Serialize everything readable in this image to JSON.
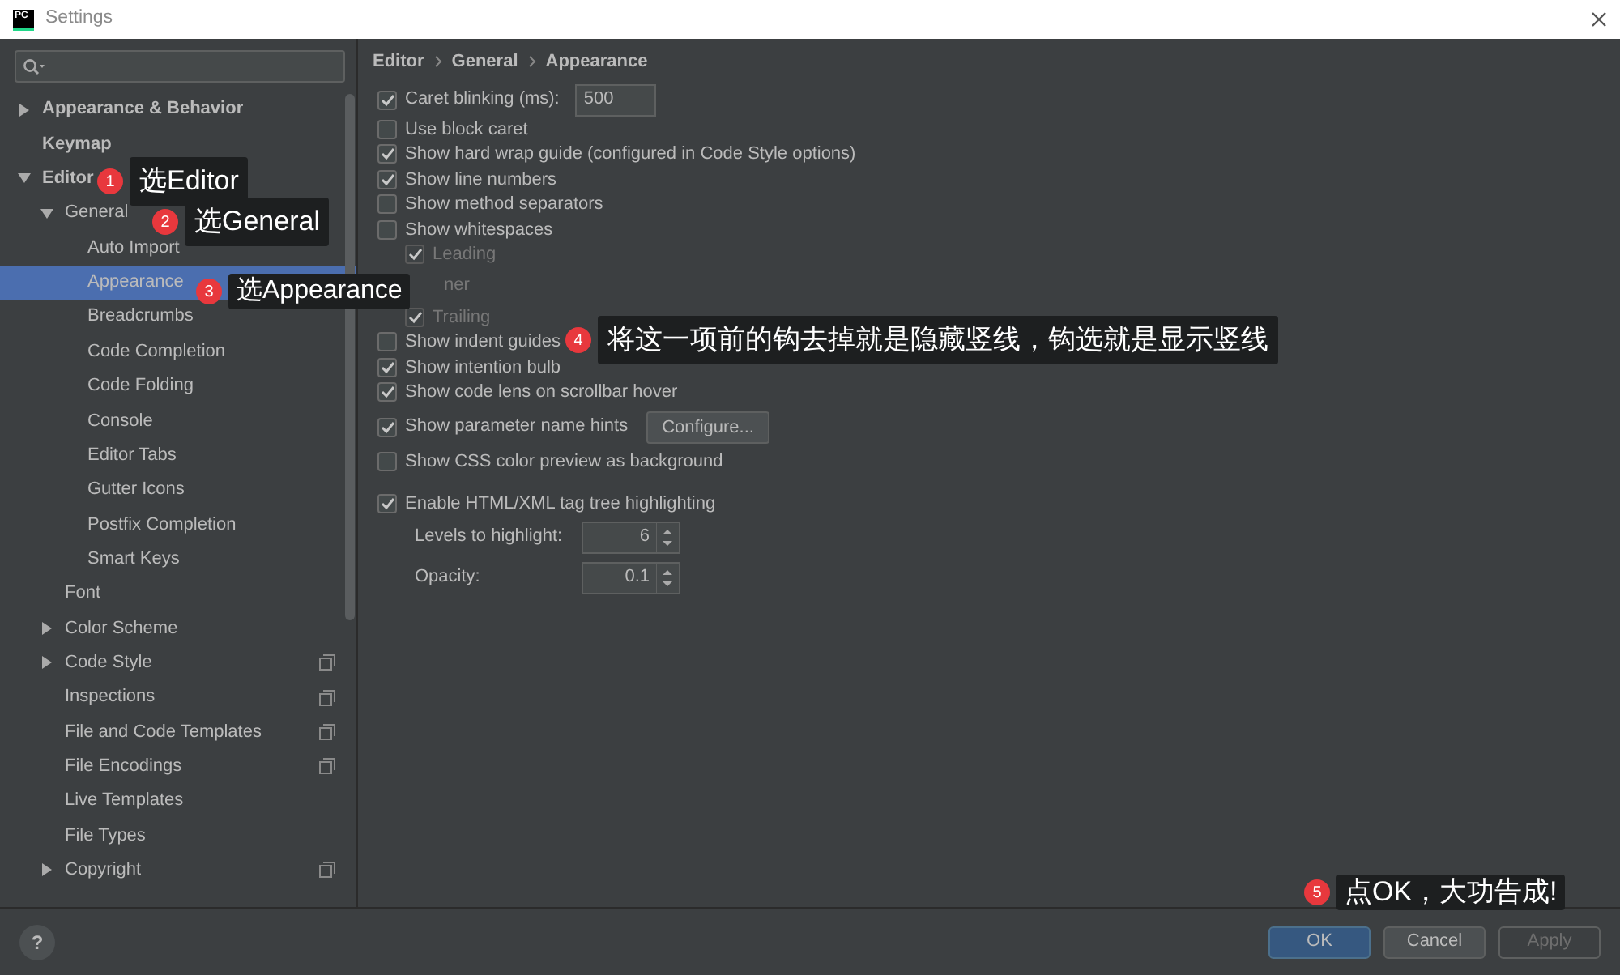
{
  "window": {
    "app_badge": "PC",
    "title": "Settings"
  },
  "sidebar": {
    "items": [
      {
        "label": "Appearance & Behavior",
        "expanded": false,
        "selected": false
      },
      {
        "label": "Keymap",
        "selected": false
      },
      {
        "label": "Editor",
        "expanded": true,
        "selected": false,
        "children": [
          {
            "label": "General",
            "expanded": true,
            "selected": false,
            "children": [
              {
                "label": "Auto Import",
                "selected": false
              },
              {
                "label": "Appearance",
                "selected": true
              },
              {
                "label": "Breadcrumbs",
                "selected": false
              },
              {
                "label": "Code Completion",
                "selected": false
              },
              {
                "label": "Code Folding",
                "selected": false
              },
              {
                "label": "Console",
                "selected": false
              },
              {
                "label": "Editor Tabs",
                "selected": false
              },
              {
                "label": "Gutter Icons",
                "selected": false
              },
              {
                "label": "Postfix Completion",
                "selected": false
              },
              {
                "label": "Smart Keys",
                "selected": false
              }
            ]
          },
          {
            "label": "Font",
            "selected": false
          },
          {
            "label": "Color Scheme",
            "expanded": false,
            "selected": false
          },
          {
            "label": "Code Style",
            "expanded": false,
            "selected": false,
            "project": true
          },
          {
            "label": "Inspections",
            "selected": false,
            "project": true
          },
          {
            "label": "File and Code Templates",
            "selected": false,
            "project": true
          },
          {
            "label": "File Encodings",
            "selected": false,
            "project": true
          },
          {
            "label": "Live Templates",
            "selected": false
          },
          {
            "label": "File Types",
            "selected": false
          },
          {
            "label": "Copyright",
            "expanded": false,
            "selected": false,
            "project": true
          }
        ]
      }
    ]
  },
  "breadcrumbs": [
    "Editor",
    "General",
    "Appearance"
  ],
  "option_groups": [
    {
      "items": [
        {
          "kind": "checkbox",
          "label": "Caret blinking (ms):",
          "checked": true,
          "field": "500"
        },
        {
          "kind": "checkbox",
          "label": "Use block caret",
          "checked": false
        },
        {
          "kind": "checkbox",
          "label": "Show hard wrap guide (configured in Code Style options)",
          "checked": true
        },
        {
          "kind": "checkbox",
          "label": "Show line numbers",
          "checked": true
        },
        {
          "kind": "checkbox",
          "label": "Show method separators",
          "checked": false
        },
        {
          "kind": "checkbox",
          "label": "Show whitespaces",
          "checked": false,
          "children": [
            {
              "kind": "checkbox",
              "label": "Leading",
              "checked": true,
              "disabled": true
            },
            {
              "kind": "fragment",
              "label": "ner"
            },
            {
              "kind": "checkbox",
              "label": "Trailing",
              "checked": true,
              "disabled": true
            }
          ]
        },
        {
          "kind": "checkbox",
          "label": "Show indent guides",
          "checked": false
        },
        {
          "kind": "checkbox",
          "label": "Show intention bulb",
          "checked": true
        },
        {
          "kind": "checkbox",
          "label": "Show code lens on scrollbar hover",
          "checked": true
        },
        {
          "kind": "checkbox",
          "label": "Show parameter name hints",
          "checked": true,
          "button": "Configure..."
        },
        {
          "kind": "checkbox",
          "label": "Show CSS color preview as background",
          "checked": false
        }
      ]
    },
    {
      "items": [
        {
          "kind": "checkbox",
          "label": "Enable HTML/XML tag tree highlighting",
          "checked": true,
          "children": [
            {
              "kind": "spinner",
              "label": "Levels to highlight:",
              "value": "6"
            },
            {
              "kind": "spinner",
              "label": "Opacity:",
              "value": "0.1"
            }
          ]
        }
      ]
    }
  ],
  "footer": {
    "help": "?",
    "buttons": [
      {
        "label": "OK",
        "primary": true,
        "disabled": false
      },
      {
        "label": "Cancel",
        "primary": false,
        "disabled": false
      },
      {
        "label": "Apply",
        "primary": false,
        "disabled": true
      }
    ]
  },
  "callouts": [
    {
      "number": "1",
      "text": "选Editor"
    },
    {
      "number": "2",
      "text": "选General"
    },
    {
      "number": "3",
      "text": "选Appearance"
    },
    {
      "number": "4",
      "text": "将这一项前的钩去掉就是隐藏竖线，钩选就是显示竖线"
    },
    {
      "number": "5",
      "text": "点OK，大功告成!"
    }
  ]
}
